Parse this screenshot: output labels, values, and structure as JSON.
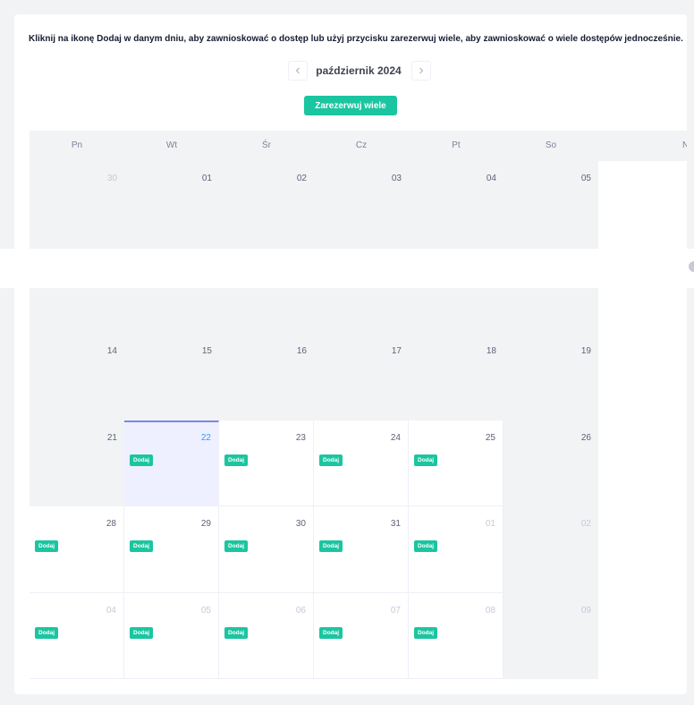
{
  "instruction": "Kliknij na ikonę Dodaj w danym dniu, aby zawnioskować o dostęp lub użyj przycisku zarezerwuj wiele, aby zawnioskować o wiele dostępów jednocześnie.",
  "calendar": {
    "month_label": "październik 2024",
    "reserve_button": "Zarezerwuj wiele",
    "add_label": "Dodaj",
    "weekdays": [
      "Pn",
      "Wt",
      "Śr",
      "Cz",
      "Pt",
      "So",
      "N"
    ],
    "rows": [
      {
        "days": [
          {
            "num": "30",
            "muted": true,
            "active": false,
            "today": false,
            "add": false
          },
          {
            "num": "01",
            "muted": false,
            "active": false,
            "today": false,
            "add": false
          },
          {
            "num": "02",
            "muted": false,
            "active": false,
            "today": false,
            "add": false
          },
          {
            "num": "03",
            "muted": false,
            "active": false,
            "today": false,
            "add": false
          },
          {
            "num": "04",
            "muted": false,
            "active": false,
            "today": false,
            "add": false
          },
          {
            "num": "05",
            "muted": false,
            "active": false,
            "today": false,
            "add": false
          }
        ]
      },
      {
        "days": [
          {
            "num": "",
            "muted": false,
            "active": false,
            "today": false,
            "add": false
          },
          {
            "num": "",
            "muted": false,
            "active": false,
            "today": false,
            "add": false
          },
          {
            "num": "",
            "muted": false,
            "active": false,
            "today": false,
            "add": false
          },
          {
            "num": "",
            "muted": false,
            "active": false,
            "today": false,
            "add": false
          },
          {
            "num": "",
            "muted": false,
            "active": false,
            "today": false,
            "add": false
          },
          {
            "num": "",
            "muted": false,
            "active": false,
            "today": false,
            "add": false
          }
        ]
      },
      {
        "days": [
          {
            "num": "14",
            "muted": false,
            "active": false,
            "today": false,
            "add": false
          },
          {
            "num": "15",
            "muted": false,
            "active": false,
            "today": false,
            "add": false
          },
          {
            "num": "16",
            "muted": false,
            "active": false,
            "today": false,
            "add": false
          },
          {
            "num": "17",
            "muted": false,
            "active": false,
            "today": false,
            "add": false
          },
          {
            "num": "18",
            "muted": false,
            "active": false,
            "today": false,
            "add": false
          },
          {
            "num": "19",
            "muted": false,
            "active": false,
            "today": false,
            "add": false
          }
        ]
      },
      {
        "days": [
          {
            "num": "21",
            "muted": false,
            "active": false,
            "today": false,
            "add": false
          },
          {
            "num": "22",
            "muted": false,
            "active": true,
            "today": true,
            "add": true
          },
          {
            "num": "23",
            "muted": false,
            "active": true,
            "today": false,
            "add": true
          },
          {
            "num": "24",
            "muted": false,
            "active": true,
            "today": false,
            "add": true
          },
          {
            "num": "25",
            "muted": false,
            "active": true,
            "today": false,
            "add": true
          },
          {
            "num": "26",
            "muted": false,
            "active": false,
            "today": false,
            "add": false
          }
        ]
      },
      {
        "days": [
          {
            "num": "28",
            "muted": false,
            "active": true,
            "today": false,
            "add": true
          },
          {
            "num": "29",
            "muted": false,
            "active": true,
            "today": false,
            "add": true
          },
          {
            "num": "30",
            "muted": false,
            "active": true,
            "today": false,
            "add": true
          },
          {
            "num": "31",
            "muted": false,
            "active": true,
            "today": false,
            "add": true
          },
          {
            "num": "01",
            "muted": true,
            "active": true,
            "today": false,
            "add": true
          },
          {
            "num": "02",
            "muted": true,
            "active": false,
            "today": false,
            "add": false
          }
        ]
      },
      {
        "days": [
          {
            "num": "04",
            "muted": true,
            "active": true,
            "today": false,
            "add": true
          },
          {
            "num": "05",
            "muted": true,
            "active": true,
            "today": false,
            "add": true
          },
          {
            "num": "06",
            "muted": true,
            "active": true,
            "today": false,
            "add": true
          },
          {
            "num": "07",
            "muted": true,
            "active": true,
            "today": false,
            "add": true
          },
          {
            "num": "08",
            "muted": true,
            "active": true,
            "today": false,
            "add": true
          },
          {
            "num": "09",
            "muted": true,
            "active": false,
            "today": false,
            "add": false
          }
        ]
      }
    ]
  },
  "colors": {
    "accent": "#1bc5a0",
    "today_bg": "#eef0ff",
    "today_border": "#7b86e8",
    "today_text": "#3699ff",
    "inactive_bg": "#f2f3f5"
  }
}
